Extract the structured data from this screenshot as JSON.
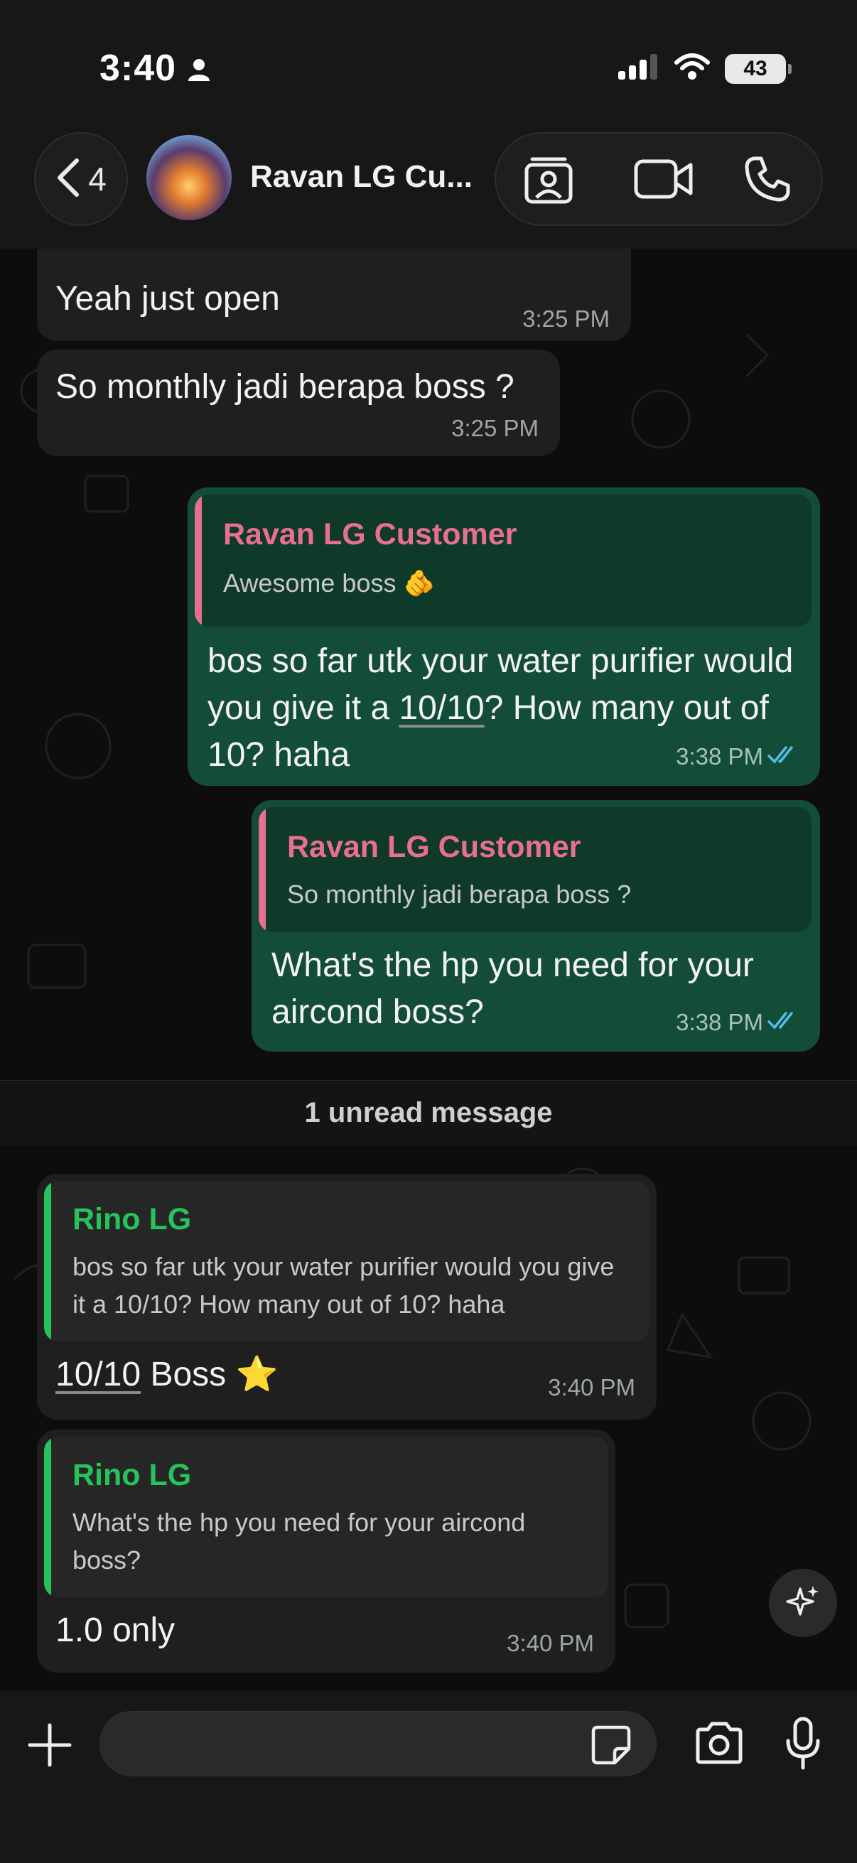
{
  "status": {
    "time": "3:40",
    "battery": "43"
  },
  "header": {
    "back_count": "4",
    "contact_name": "Ravan LG Cu..."
  },
  "messages": [
    {
      "text": "Yeah just open",
      "time": "3:25 PM"
    },
    {
      "text": "So monthly jadi berapa boss ?",
      "time": "3:25 PM"
    },
    {
      "quote_name": "Ravan LG Customer",
      "quote_text": "Awesome boss 🫵",
      "text_parts": [
        "bos so far utk your water purifier would you give it a ",
        "10/10",
        "? How many out of 10? haha"
      ],
      "time": "3:38 PM"
    },
    {
      "quote_name": "Ravan LG Customer",
      "quote_text": "So monthly jadi berapa boss ?",
      "text": "What's the hp you need for your aircond boss?",
      "time": "3:38 PM"
    },
    {
      "quote_name": "Rino LG",
      "quote_text": "bos so far utk your water purifier would you give it a 10/10? How many out of 10? haha",
      "text_parts": [
        "10/10",
        " Boss ⭐"
      ],
      "time": "3:40 PM"
    },
    {
      "quote_name": "Rino LG",
      "quote_text": "What's the hp you need for your aircond boss?",
      "text": "1.0 only",
      "time": "3:40 PM"
    }
  ],
  "divider": {
    "label": "1 unread message"
  },
  "input": {
    "value": ""
  },
  "colors": {
    "outgoing": "#134d37",
    "incoming": "#1f1f1f",
    "quote_pink": "#e86f8f",
    "quote_green": "#25c35a",
    "read_ticks": "#53bdeb"
  }
}
